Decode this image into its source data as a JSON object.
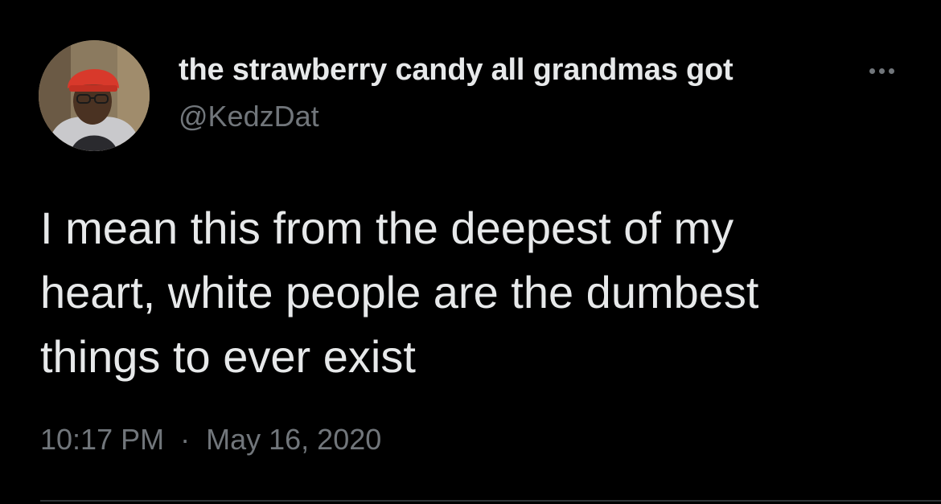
{
  "tweet": {
    "author": {
      "display_name": "the strawberry candy all grandmas got",
      "handle": "@KedzDat",
      "avatar": "avatar-photo"
    },
    "text_lines": [
      "I mean this from the deepest of my",
      "heart, white people are the dumbest",
      "things to ever exist"
    ],
    "time": "10:17 PM",
    "separator": "·",
    "date": "May 16, 2020",
    "more_icon": "more-horizontal-icon"
  },
  "colors": {
    "background": "#000000",
    "primary_text": "#e7e9ea",
    "secondary_text": "#71767b",
    "divider": "#2f3336"
  }
}
